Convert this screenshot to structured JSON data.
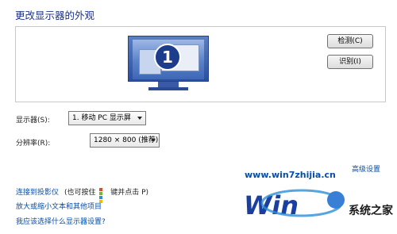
{
  "page": {
    "title": "更改显示器的外观"
  },
  "preview": {
    "monitor_number": "1",
    "detect_button": "检测(C)",
    "identify_button": "识别(I)"
  },
  "settings": {
    "display_label": "显示器(S):",
    "display_value": "1. 移动 PC 显示屏",
    "resolution_label": "分辨率(R):",
    "resolution_value": "1280 × 800 (推荐)"
  },
  "links": {
    "advanced": "高级设置",
    "projector": "连接到投影仪",
    "projector_hint_before": "(也可按住",
    "projector_hint_after": "键并点击 P)",
    "enlarge": "放大或缩小文本和其他项目",
    "which_display": "我应该选择什么显示器设置?"
  },
  "watermark": {
    "url": "www.win7zhijia.cn",
    "logo_text": "系统之家",
    "logo_mark": "Win"
  },
  "colors": {
    "title": "#1e3287",
    "link": "#0a4da3",
    "monitor": "#2b4fa0"
  }
}
